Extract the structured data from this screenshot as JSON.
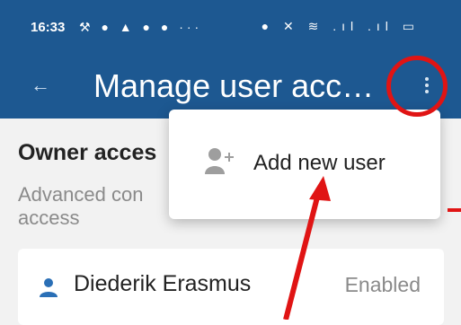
{
  "status_bar": {
    "time": "16:33",
    "left_icons": "⚒ ● ▲ ● ● ···",
    "right_icons": "● ✕ ≋ .ıl .ıl ▭"
  },
  "app_bar": {
    "title": "Manage user acc…"
  },
  "section": {
    "title": "Owner acces",
    "subtitle": "Advanced con access"
  },
  "user": {
    "name": "Diederik Erasmus",
    "status": "Enabled"
  },
  "menu": {
    "add_user_label": "Add new user"
  },
  "colors": {
    "app_bar": "#1d5891",
    "annotation": "#e01414",
    "icon_blue": "#2a6fb6"
  }
}
